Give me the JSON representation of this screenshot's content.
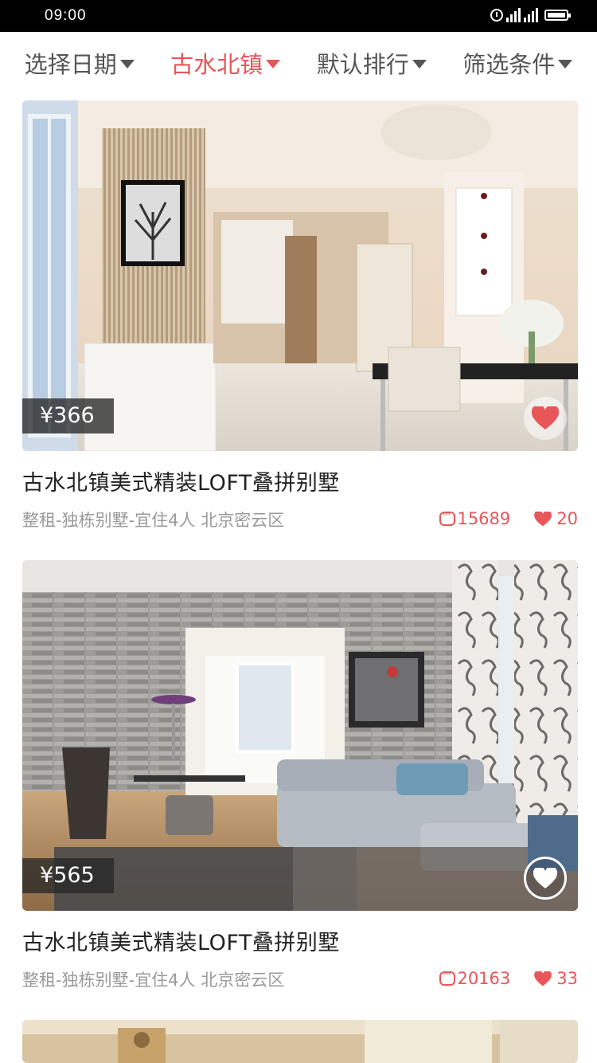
{
  "status_bar": {
    "time": "09:00"
  },
  "filters": [
    {
      "label": "选择日期",
      "active": false
    },
    {
      "label": "古水北镇",
      "active": true
    },
    {
      "label": "默认排行",
      "active": false
    },
    {
      "label": "筛选条件",
      "active": false
    }
  ],
  "listings": [
    {
      "price": "¥366",
      "title": "古水北镇美式精装LOFT叠拼别墅",
      "info": "整租-独栋别墅-宜住4人   北京密云区",
      "comments": "15689",
      "likes": "20",
      "favorited": true
    },
    {
      "price": "¥565",
      "title": "古水北镇美式精装LOFT叠拼别墅",
      "info": "整租-独栋别墅-宜住4人   北京密云区",
      "comments": "20163",
      "likes": "33",
      "favorited": false
    }
  ],
  "colors": {
    "accent": "#e8565a",
    "muted": "#9a9a9a"
  },
  "icons": [
    "alarm-icon",
    "signal-icon",
    "battery-icon",
    "caret-down-icon",
    "heart-icon",
    "comment-icon"
  ]
}
